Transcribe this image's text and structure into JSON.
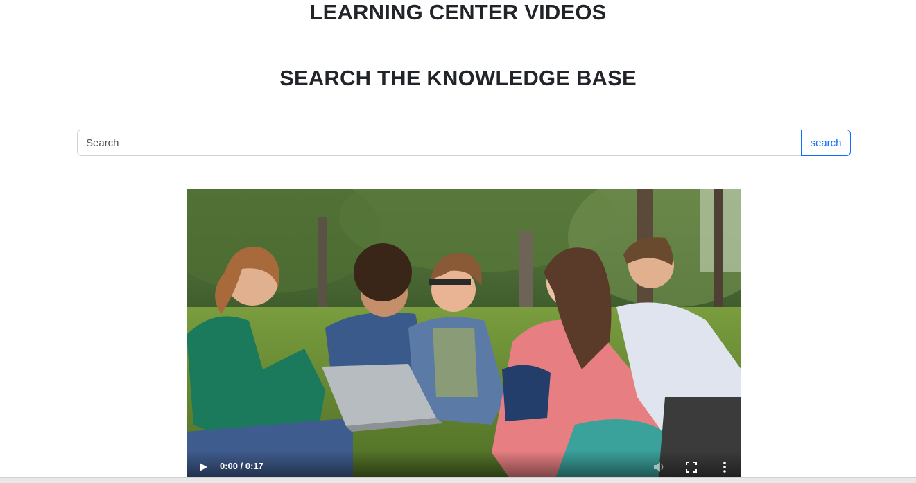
{
  "header": {
    "title": "LEARNING CENTER VIDEOS",
    "subtitle": "SEARCH THE KNOWLEDGE BASE"
  },
  "search": {
    "placeholder": "Search",
    "value": "",
    "button_label": "search"
  },
  "video": {
    "time": "0:00 / 0:17",
    "progress": 0,
    "icons": [
      "play-icon",
      "volume-icon",
      "fullscreen-icon",
      "more-options-icon"
    ]
  },
  "colors": {
    "accent": "#0d6efd",
    "text": "#212529",
    "input_border": "#ced4da"
  }
}
